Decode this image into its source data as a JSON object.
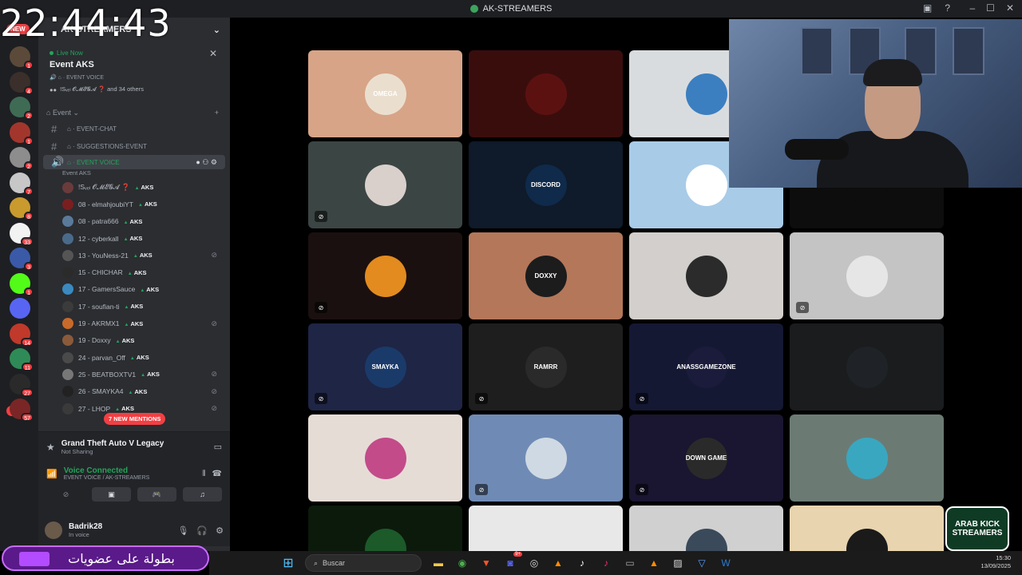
{
  "clock": "22:44:43",
  "window": {
    "title": "AK-STREAMERS"
  },
  "server": {
    "name": "AK-STREAMERS"
  },
  "rail": {
    "new_top": "NEW",
    "new_bottom": "NEW",
    "servers": [
      {
        "badge": "1",
        "color": "#5b4a3a"
      },
      {
        "badge": "4",
        "color": "#3a2f2a"
      },
      {
        "badge": "2",
        "color": "#3f6b55"
      },
      {
        "badge": "1",
        "color": "#a3362c"
      },
      {
        "badge": "2",
        "color": "#8d8d8d"
      },
      {
        "badge": "7",
        "color": "#c7c7c7"
      },
      {
        "badge": "8",
        "color": "#c99a2e"
      },
      {
        "badge": "33",
        "color": "#f2f2f2"
      },
      {
        "badge": "3",
        "color": "#3a5aa8"
      },
      {
        "badge": "1",
        "color": "#53fc18"
      },
      {
        "badge": "",
        "color": "#5865f2"
      },
      {
        "badge": "14",
        "color": "#c0392b"
      },
      {
        "badge": "11",
        "color": "#2e8b57"
      },
      {
        "badge": "27",
        "color": "#2a2a2a"
      },
      {
        "badge": "57",
        "color": "#7a2626"
      }
    ]
  },
  "live_event": {
    "live_label": "Live Now",
    "title": "Event AKS",
    "channel": "EVENT VOICE",
    "people": "!Sᵥₑₗ 𝓞𝓜𝓔𝓖𝓐 ❓ and 34 others"
  },
  "category": "Event",
  "channels": [
    {
      "name": "EVENT-CHAT"
    },
    {
      "name": "SUGGESTIONS-EVENT"
    }
  ],
  "voice_channel": {
    "name": "EVENT VOICE",
    "status": "Event AKS"
  },
  "members": [
    {
      "name": "!Sᵥₑₗ 𝓞𝓜𝓔𝓖𝓐 ❓",
      "color": "#6b3b3b",
      "muted": false
    },
    {
      "name": "08 - elmahjoubiYT",
      "color": "#7a1f1f",
      "muted": false
    },
    {
      "name": "08 - patra666",
      "color": "#5a7a9a",
      "muted": false
    },
    {
      "name": "12 - cyberkall",
      "color": "#4a6a8a",
      "muted": false
    },
    {
      "name": "13 - YouNess-21",
      "color": "#555",
      "muted": true
    },
    {
      "name": "15 - CHICHAR",
      "color": "#2b2b2b",
      "muted": false
    },
    {
      "name": "17 - GamersSauce",
      "color": "#3a8ac0",
      "muted": false
    },
    {
      "name": "17 - soufian-ti",
      "color": "#3b3b3b",
      "muted": false
    },
    {
      "name": "19 - AKRMX1",
      "color": "#c86a2a",
      "muted": true
    },
    {
      "name": "19 - Doxxy",
      "color": "#8b5a3a",
      "muted": false
    },
    {
      "name": "24 - parvan_Off",
      "color": "#4a4a4a",
      "muted": false
    },
    {
      "name": "25 - BEATBOXTV1",
      "color": "#777",
      "muted": true
    },
    {
      "name": "26 - SMAYKA4",
      "color": "#222",
      "muted": true
    },
    {
      "name": "27 - LHOP",
      "color": "#3a3a3a",
      "muted": true
    }
  ],
  "mentions_label": "7 NEW MENTIONS",
  "activity": {
    "game": "Grand Theft Auto V Legacy",
    "status": "Not Sharing"
  },
  "voice_status": {
    "label": "Voice Connected",
    "channel": "EVENT VOICE / AK-STREAMERS"
  },
  "user": {
    "name": "Badrik28",
    "status": "In voice"
  },
  "tiles": [
    {
      "bg": "#d7a487",
      "pfp": "#eadfcf",
      "label": "OMEGA",
      "muted": false
    },
    {
      "bg": "#3a0d0d",
      "pfp": "#5c1111",
      "label": "",
      "muted": false
    },
    {
      "bg": "#d9dcdf",
      "pfp": "#3b7fc0",
      "label": "",
      "muted": false
    },
    {
      "bg": "#1c1c1c",
      "pfp": "#1c1c1c",
      "label": "",
      "muted": false
    },
    {
      "bg": "#3b4544",
      "pfp": "#d9d0cc",
      "label": "",
      "muted": true
    },
    {
      "bg": "#0f1a2a",
      "pfp": "#0f2a4a",
      "label": "DISCORD",
      "muted": false
    },
    {
      "bg": "#a8cbe8",
      "pfp": "#ffffff",
      "label": "",
      "muted": false
    },
    {
      "bg": "#0d0d0d",
      "pfp": "#0d0d0d",
      "label": "",
      "muted": false
    },
    {
      "bg": "#1b1010",
      "pfp": "#e38b1e",
      "label": "",
      "muted": true
    },
    {
      "bg": "#b4775a",
      "pfp": "#1c1c1c",
      "label": "DOXXY",
      "muted": false
    },
    {
      "bg": "#d2cfcc",
      "pfp": "#2b2b2b",
      "label": "",
      "muted": false
    },
    {
      "bg": "#c4c4c4",
      "pfp": "#e6e6e6",
      "label": "",
      "muted": true
    },
    {
      "bg": "#1f2545",
      "pfp": "#1a3a6a",
      "label": "SMAYKA",
      "muted": true
    },
    {
      "bg": "#1e1e1e",
      "pfp": "#2a2a2a",
      "label": "RAMRR",
      "muted": true
    },
    {
      "bg": "#151833",
      "pfp": "#1b1b3b",
      "label": "ANASSGAMEZONE",
      "muted": true
    },
    {
      "bg": "#1a1c1e",
      "pfp": "#1f2327",
      "label": "",
      "muted": false
    },
    {
      "bg": "#e6dcd6",
      "pfp": "#c34b8a",
      "label": "",
      "muted": false
    },
    {
      "bg": "#6f8bb5",
      "pfp": "#cfd9e3",
      "label": "",
      "muted": true
    },
    {
      "bg": "#1a1530",
      "pfp": "#2a2a2a",
      "label": "DOWN GAME",
      "muted": true
    },
    {
      "bg": "#6b7b74",
      "pfp": "#3aa7c0",
      "label": "",
      "muted": false
    },
    {
      "bg": "#0c1a0c",
      "pfp": "#1c5a2a",
      "label": "",
      "muted": false
    },
    {
      "bg": "#e8e8e8",
      "pfp": "#e8e8e8",
      "label": "",
      "muted": false
    },
    {
      "bg": "#d0d0d0",
      "pfp": "#3a4a5a",
      "label": "",
      "muted": false
    },
    {
      "bg": "#e8d4ae",
      "pfp": "#1a1a1a",
      "label": "",
      "muted": false
    }
  ],
  "banner_text": "بطولة على عضويات",
  "taskbar": {
    "search_placeholder": "Buscar",
    "time": "15:30",
    "date": "13/09/2025",
    "chrome_badge": "9+"
  },
  "watermark": "ARAB KICK STREAMERS"
}
